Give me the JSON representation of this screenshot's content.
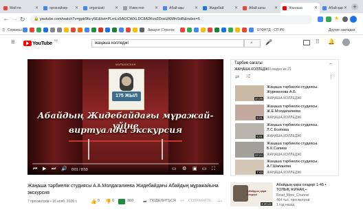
{
  "tabs": [
    {
      "label": "Мой по",
      "color": "#e8453c"
    },
    {
      "label": "органайзер",
      "color": "#4285f4"
    },
    {
      "label": "organizati",
      "color": "#4285f4"
    },
    {
      "label": "Известия",
      "color": "#9aa0a6"
    },
    {
      "label": "Абай ақы",
      "color": "#4285f4"
    },
    {
      "label": "Жидебай",
      "color": "#1a73e8"
    },
    {
      "label": "Абай шеш",
      "color": "#e8453c"
    },
    {
      "label": "Жанаша",
      "color": "#ff0000"
    },
    {
      "label": "Абай қар",
      "color": "#4285f4"
    }
  ],
  "address": {
    "url": "youtube.com/watch?v=gptr9fu-y5E&list=PLmLs5AOCWXLDC8A2Kvo2DoxUKMfnSoB&index=6"
  },
  "bookmarks": {
    "apps_label": "Сервисы",
    "folder_label": "Аккаунт Стрелок",
    "folder2_label": "ЕГФНТД - СП РК",
    "other_label": "Другие закладки"
  },
  "youtube": {
    "logo": "YouTube",
    "country": "KZ",
    "search_value": "жаңаша колледжі"
  },
  "player": {
    "banner": "МАРШАКСКАН",
    "years": "175 ЖЫЛ",
    "line1": "Абайдың Жидебайдағы мұражай-үйіне",
    "line2": "виртуалды экскурсия",
    "time": "0:01 / 8:53"
  },
  "playlist": {
    "title": "Тарбие сағаты",
    "channel": "ЖАҢАША КОЛЛЕДЖІ",
    "position": "6 видео из 21"
  },
  "playlist_items": [
    {
      "title": "Жаңаша тәрбиелік студиясы. Журекенова А.Б.",
      "channel": "ЖАҢАША КОЛЛЕДЖІ",
      "duration": "10:26",
      "color": "#c9b9a5"
    },
    {
      "title": "Жаңаша тәрбиелік студиясы. Ж.Е.Молдагалиева",
      "channel": "ЖАҢАША КОЛЛЕДЖІ",
      "duration": "6:21",
      "color": "#c4a9a0"
    },
    {
      "title": "Жаңаша тәрбиелік студиясы. Л.С.Есенова",
      "channel": "ЖАҢАША КОЛЛЕДЖІ",
      "duration": "5:01",
      "color": "#b9b3ae"
    },
    {
      "title": "Жаңаша тәрбиелік студиясы. Б.К.Сапиев",
      "channel": "ЖАҢАША КОЛЛЕДЖІ",
      "duration": "23:24",
      "color": "#a3a09b"
    },
    {
      "title": "Жаңаша тәрбиелік студиясы. А.Г.Шапанова",
      "channel": "ЖАҢАША КОЛЛЕДЖІ",
      "duration": "7:43",
      "color": "#d3c6b7"
    }
  ],
  "recommended": {
    "title": "Абайдың қара сөздері 1-45 • ТОЛЫҚ ЖИНАҚ •",
    "channel": "Read_More_Channel",
    "views": "464 тыс. просмотров",
    "age": "1 год назад",
    "duration": "3:20:22",
    "thumb_text": "Абайдың қара сөздері"
  },
  "video": {
    "title": "Жаңаша тәрбиелік студиясы А.А.Молдагалиева Жидебайдағы Абайдың мұражайына экскурсия",
    "meta": "7 просмотров • 16 нояб. 2020 г.",
    "likes": "0",
    "dislikes": "0",
    "quality": "360",
    "share": "ПОДЕЛИТЬСЯ",
    "save": "СОХРАНИТЬ"
  }
}
